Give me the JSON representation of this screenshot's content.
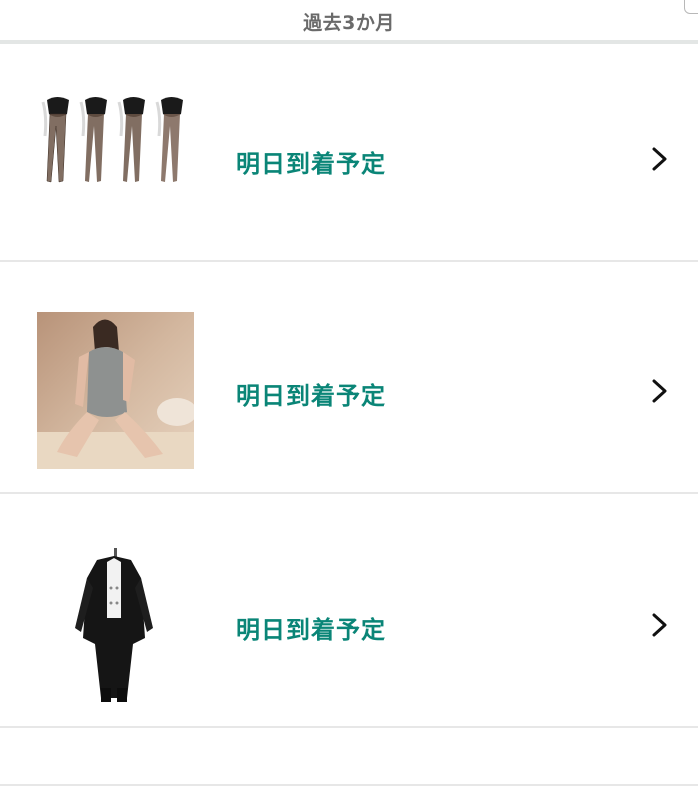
{
  "header": {
    "title": "過去3か月"
  },
  "orders": [
    {
      "image_icon": "fishnet-stockings-product-photo",
      "status": "明日到着予定",
      "arrow_icon": "chevron-right-icon"
    },
    {
      "image_icon": "knit-bodysuit-product-photo",
      "status": "明日到着予定",
      "arrow_icon": "chevron-right-icon"
    },
    {
      "image_icon": "black-coat-costume-product-photo",
      "status": "明日到着予定",
      "arrow_icon": "chevron-right-icon"
    }
  ],
  "colors": {
    "status_accent": "#0a8577",
    "header_text": "#6a6a6a",
    "divider": "#e7e7e7"
  }
}
